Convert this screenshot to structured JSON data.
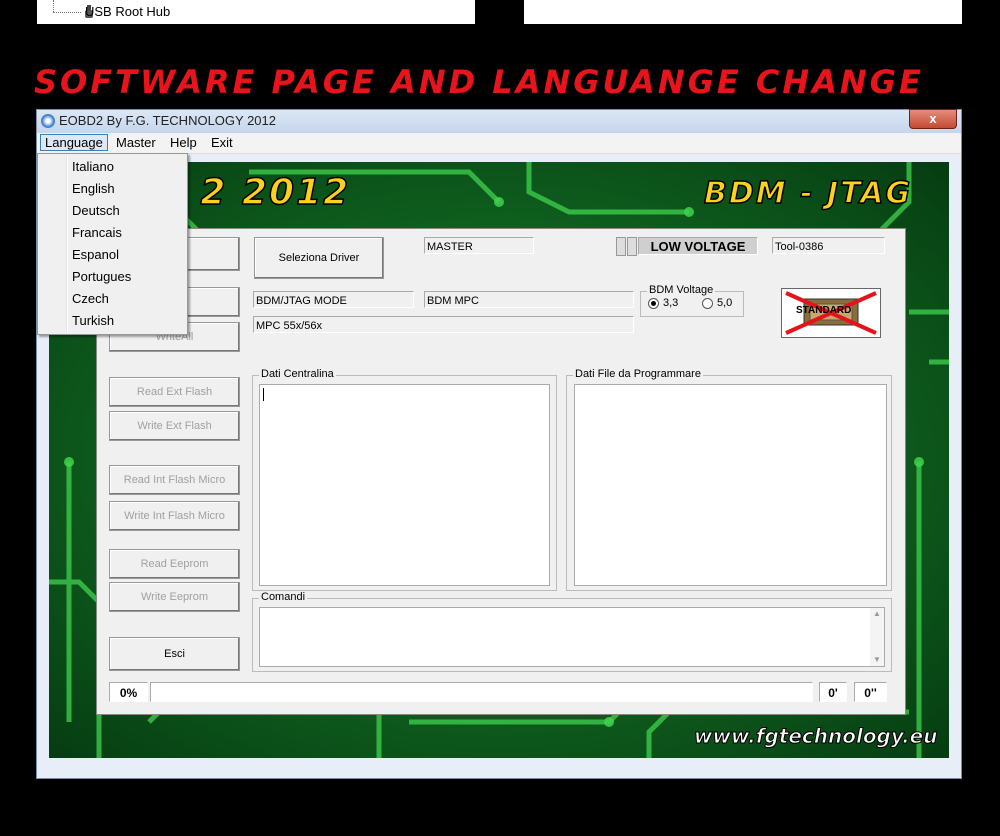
{
  "tree": {
    "item_label": "USB Root Hub"
  },
  "banner": "SOFTWARE PAGE AND LANGUANGE CHANGE",
  "window": {
    "title": "EOBD2 By F.G. TECHNOLOGY 2012",
    "close": "x"
  },
  "menu": {
    "items": [
      "Language",
      "Master",
      "Help",
      "Exit"
    ]
  },
  "language_menu": {
    "options": [
      "Italiano",
      "English",
      "Deutsch",
      "Francais",
      "Espanol",
      "Portugues",
      "Czech",
      "Turkish"
    ]
  },
  "branding": {
    "logo_left": "D 2 2012",
    "logo_right": "BDM - JTAG",
    "website": "www.fgtechnology.eu"
  },
  "buttons": {
    "connect_partial": "CT",
    "read_all_partial": "ll",
    "write_all": "WriteAll",
    "read_ext_flash": "Read Ext Flash",
    "write_ext_flash": "Write Ext Flash",
    "read_int_flash": "Read Int Flash Micro",
    "write_int_flash": "Write Int Flash Micro",
    "read_eeprom": "Read Eeprom",
    "write_eeprom": "Write Eeprom",
    "exit": "Esci",
    "select_driver": "Seleziona Driver"
  },
  "fields": {
    "master": "MASTER",
    "low_voltage": "LOW VOLTAGE",
    "tool_id": "Tool-0386",
    "mode": "BDM/JTAG  MODE",
    "protocol": "BDM MPC",
    "cpu": "MPC 55x/56x"
  },
  "bdm_voltage": {
    "label": "BDM Voltage",
    "options": [
      "3,3",
      "5,0"
    ],
    "selected": "3,3"
  },
  "standard_badge": "STANDARD",
  "groups": {
    "ecu_data": "Dati Centralina",
    "file_data": "Dati File da Programmare",
    "commands": "Comandi"
  },
  "status": {
    "progress": "0%",
    "minutes": "0'",
    "seconds": "0''"
  },
  "colors": {
    "banner_red": "#e8141b",
    "logo_yellow": "#ffd11a",
    "pcb_green": "#0c5a1c"
  }
}
